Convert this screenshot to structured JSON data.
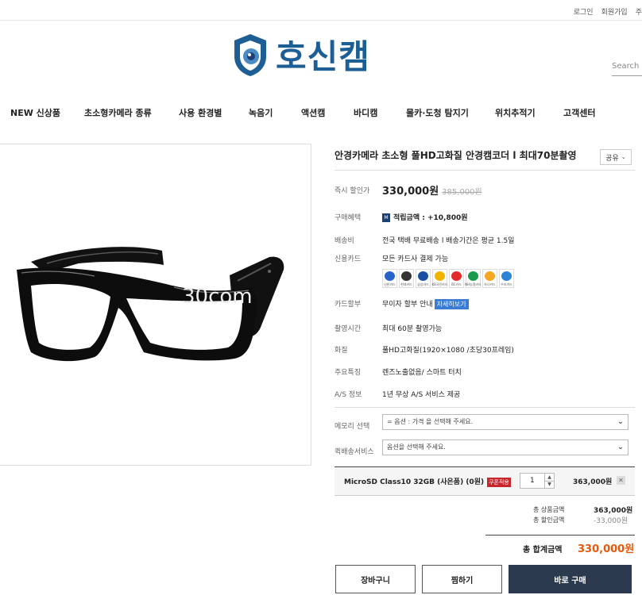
{
  "topbar": {
    "links": [
      "로그인",
      "회원가입",
      "주"
    ]
  },
  "logo": {
    "text": "호신캠"
  },
  "search": {
    "placeholder": "Search"
  },
  "nav": {
    "items": [
      "NEW 신상품",
      "초소형카메라 종류",
      "사용 환경별",
      "녹음기",
      "액션캠",
      "바디캠",
      "몰카·도청 탐지기",
      "위치추적기",
      "고객센터"
    ]
  },
  "product": {
    "title": "안경카메라 초소형 풀HD고화질 안경캠코더 l 최대70분촬영",
    "share_label": "공유",
    "watermark": "30com"
  },
  "info": {
    "sale_price": {
      "label": "즉시 할인가",
      "price": "330,000원",
      "original": "385,000원"
    },
    "benefit": {
      "label": "구매혜택",
      "badge": "M",
      "text": "적립금액 : +10,800원"
    },
    "shipping": {
      "label": "배송비",
      "text": "전국 택배 무료배송 l 배송기간은 평균 1.5일"
    },
    "credit": {
      "label": "신용카드",
      "text": "모든 카드사 결제 가능"
    },
    "cards": [
      {
        "name": "신한카드",
        "color": "#2a63c7"
      },
      {
        "name": "현대카드",
        "color": "#333333"
      },
      {
        "name": "삼성카드",
        "color": "#1a4fa3"
      },
      {
        "name": "KB국민카드",
        "color": "#f0b400"
      },
      {
        "name": "BC카드",
        "color": "#e32b2b"
      },
      {
        "name": "NH농협카드",
        "color": "#1b9a4a"
      },
      {
        "name": "하나카드",
        "color": "#f5a623"
      },
      {
        "name": "우리카드",
        "color": "#2b82d6"
      }
    ],
    "installment": {
      "label": "카드할부",
      "text": "무이자 할부 안내",
      "button": "자세히보기"
    },
    "recording": {
      "label": "촬영시간",
      "text": "최대 60분 촬영가능"
    },
    "quality": {
      "label": "화질",
      "text": "풀HD고화질(1920×1080 /초당30프레임)"
    },
    "features": {
      "label": "주요특징",
      "text": "렌즈노출없음/ 스마트 터치"
    },
    "as": {
      "label": "A/S 정보",
      "text": "1년 무상 A/S 서비스 제공"
    }
  },
  "options": {
    "memory": {
      "label": "메모리 선택",
      "value": "= 옵션 : 가격 을 선택해 주세요."
    },
    "quick": {
      "label": "퀵배송서비스",
      "value": "옵션을 선택해 주세요."
    }
  },
  "selected": {
    "name": "MicroSD Class10 32GB (사은품) (0원)",
    "coupon": "쿠폰적용",
    "quantity": "1",
    "price": "363,000원"
  },
  "summary": {
    "total_product_label": "총 상품금액",
    "total_product": "363,000원",
    "total_discount_label": "총 할인금액",
    "total_discount": "-33,000원",
    "total_label": "총 합계금액",
    "total": "330,000원"
  },
  "buttons": {
    "cart": "장바구니",
    "wish": "찜하기",
    "buy": "바로 구매"
  },
  "colors": {
    "accent": "#e8590c",
    "brand": "#1d5e94",
    "buy_button": "#2b3a4f",
    "coupon": "#c8252d"
  }
}
